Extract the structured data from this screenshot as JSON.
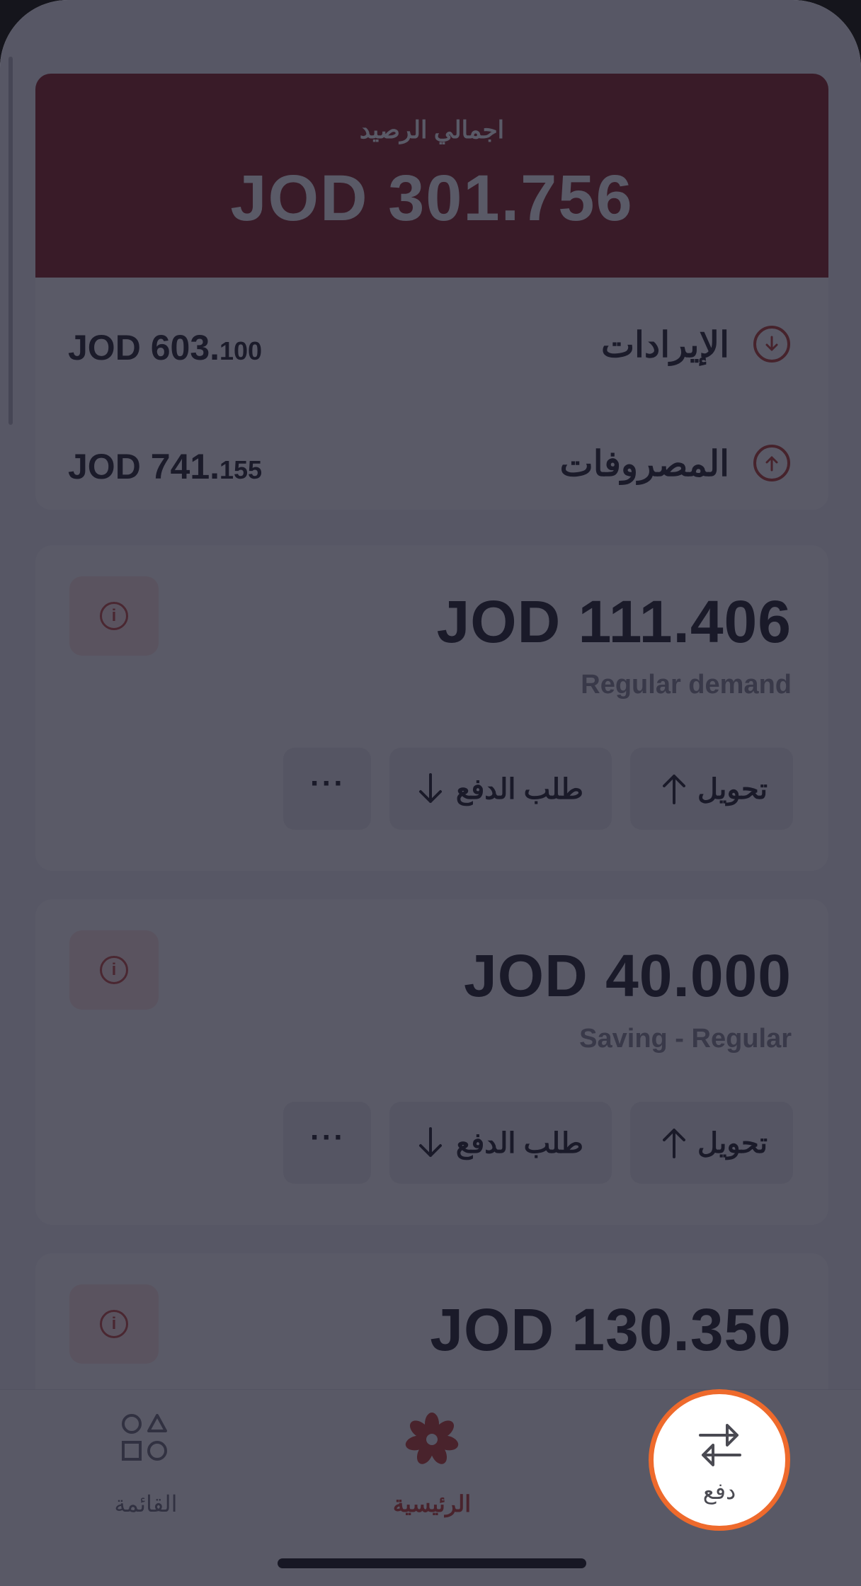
{
  "balance": {
    "label": "اجمالي الرصيد",
    "value": "JOD 301.756"
  },
  "summary": {
    "income": {
      "label": "الإيرادات",
      "amount_main": "JOD 603.",
      "amount_small": "100",
      "icon": "arrow-down-circle-icon"
    },
    "expenses": {
      "label": "المصروفات",
      "amount_main": "JOD 741.",
      "amount_small": "155",
      "icon": "arrow-up-circle-icon"
    }
  },
  "accounts": [
    {
      "amount": "JOD 111.406",
      "type": "Regular demand",
      "transfer_label": "تحويل",
      "request_label": "طلب الدفع",
      "more_label": "···"
    },
    {
      "amount": "JOD 40.000",
      "type": "Saving - Regular",
      "transfer_label": "تحويل",
      "request_label": "طلب الدفع",
      "more_label": "···"
    },
    {
      "amount": "JOD 130.350"
    }
  ],
  "tabbar": {
    "menu": {
      "label": "القائمة",
      "icon": "shapes-menu-icon"
    },
    "home": {
      "label": "الرئيسية",
      "icon": "flower-logo-icon"
    },
    "pay": {
      "label": "دفع",
      "icon": "swap-arrows-icon"
    }
  },
  "colors": {
    "brand_red": "#8a1f1f",
    "accent_red": "#c0392b",
    "spotlight_ring": "#ee6a2c",
    "overlay": "rgba(26,26,44,0.72)"
  }
}
